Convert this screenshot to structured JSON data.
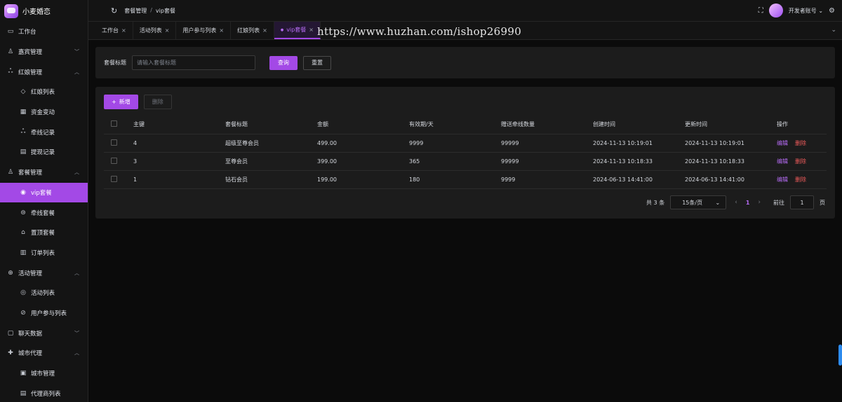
{
  "app": {
    "name": "小麦婚恋",
    "logo_icon": "app-logo-icon"
  },
  "sidebar": {
    "items": [
      {
        "label": "工作台",
        "icon": "monitor-icon",
        "level": 1
      },
      {
        "label": "嘉宾管理",
        "icon": "user-icon",
        "level": 1,
        "arrow": "expand"
      },
      {
        "label": "红娘管理",
        "icon": "group-icon",
        "level": 1,
        "arrow": "collapse"
      },
      {
        "label": "红娘列表",
        "icon": "gem-icon",
        "level": 2
      },
      {
        "label": "资金变动",
        "icon": "grid-icon",
        "level": 2
      },
      {
        "label": "牵线记录",
        "icon": "group-icon",
        "level": 2
      },
      {
        "label": "提现记录",
        "icon": "clipboard-icon",
        "level": 2
      },
      {
        "label": "套餐管理",
        "icon": "user-icon",
        "level": 1,
        "arrow": "collapse"
      },
      {
        "label": "vip套餐",
        "icon": "vip-icon",
        "level": 2,
        "active": true
      },
      {
        "label": "牵线套餐",
        "icon": "link-icon",
        "level": 2
      },
      {
        "label": "置顶套餐",
        "icon": "pin-icon",
        "level": 2
      },
      {
        "label": "订单列表",
        "icon": "document-icon",
        "level": 2
      },
      {
        "label": "活动管理",
        "icon": "globe-icon",
        "level": 1,
        "arrow": "collapse"
      },
      {
        "label": "活动列表",
        "icon": "chrome-icon",
        "level": 2
      },
      {
        "label": "用户参与列表",
        "icon": "check-circle-icon",
        "level": 2
      },
      {
        "label": "聊天数据",
        "icon": "chat-icon",
        "level": 1,
        "arrow": "expand"
      },
      {
        "label": "城市代理",
        "icon": "plus-circle-icon",
        "level": 1,
        "arrow": "collapse"
      },
      {
        "label": "城市管理",
        "icon": "building-icon",
        "level": 2
      },
      {
        "label": "代理商列表",
        "icon": "list-icon",
        "level": 2
      }
    ]
  },
  "header": {
    "breadcrumb": [
      "套餐管理",
      "vip套餐"
    ],
    "account": "开发者账号"
  },
  "tabs": [
    {
      "label": "工作台",
      "active": false
    },
    {
      "label": "活动列表",
      "active": false
    },
    {
      "label": "用户参与列表",
      "active": false
    },
    {
      "label": "红娘列表",
      "active": false
    },
    {
      "label": "vip套餐",
      "active": true
    }
  ],
  "watermark": "https://www.huzhan.com/ishop26990",
  "search": {
    "label": "套餐标题",
    "placeholder": "请输入套餐标题",
    "value": "",
    "query_label": "查询",
    "reset_label": "重置"
  },
  "toolbar": {
    "add_label": "新增",
    "delete_label": "删除"
  },
  "table": {
    "columns": [
      "主键",
      "套餐标题",
      "金额",
      "有效期/天",
      "赠送牵线数量",
      "创建时间",
      "更新时间",
      "操作"
    ],
    "rows": [
      {
        "id": "4",
        "title": "超级至尊会员",
        "amount": "499.00",
        "days": "9999",
        "gift": "99999",
        "created": "2024-11-13 10:19:01",
        "updated": "2024-11-13 10:19:01"
      },
      {
        "id": "3",
        "title": "至尊会员",
        "amount": "399.00",
        "days": "365",
        "gift": "99999",
        "created": "2024-11-13 10:18:33",
        "updated": "2024-11-13 10:18:33"
      },
      {
        "id": "1",
        "title": "钻石会员",
        "amount": "199.00",
        "days": "180",
        "gift": "9999",
        "created": "2024-06-13 14:41:00",
        "updated": "2024-06-13 14:41:00"
      }
    ],
    "edit_label": "编辑",
    "delete_label": "删除"
  },
  "pagination": {
    "total_text": "共 3 条",
    "page_size": "15条/页",
    "current_page": "1",
    "goto_label": "前往",
    "goto_value": "1",
    "page_suffix": "页"
  },
  "colors": {
    "accent": "#a349e6",
    "danger": "#f05b5b",
    "background": "#0b0b0b",
    "panel": "#1c1c1c"
  }
}
